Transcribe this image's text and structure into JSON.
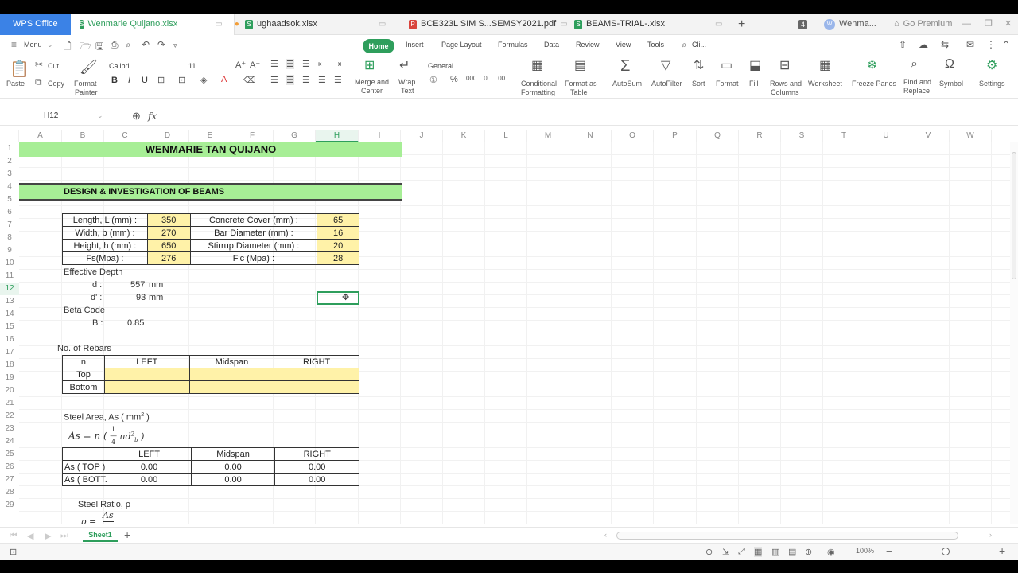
{
  "tabs": {
    "wps": "WPS Office",
    "doc1": "Wenmarie Quijano.xlsx",
    "doc2": "ughaadsok.xlsx",
    "doc3": "BCE323L SIM S...SEMSY2021.pdf",
    "doc4": "BEAMS-TRIAL-.xlsx",
    "badge": "4",
    "user": "Wenma...",
    "premium": "Go Premium"
  },
  "menu": {
    "menu": "Menu",
    "home": "Home",
    "insert": "Insert",
    "page_layout": "Page Layout",
    "formulas": "Formulas",
    "data": "Data",
    "review": "Review",
    "view": "View",
    "tools": "Tools",
    "search": "Cli..."
  },
  "ribbon": {
    "paste": "Paste",
    "cut": "Cut",
    "copy": "Copy",
    "format_painter_1": "Format",
    "format_painter_2": "Painter",
    "font": "Calibri",
    "size": "11",
    "merge_1": "Merge and",
    "merge_2": "Center",
    "wrap_1": "Wrap",
    "wrap_2": "Text",
    "number_format": "General",
    "cond_1": "Conditional",
    "cond_2": "Formatting",
    "fat_1": "Format as",
    "fat_2": "Table",
    "autosum": "AutoSum",
    "autofilter": "AutoFilter",
    "sort": "Sort",
    "format": "Format",
    "fill": "Fill",
    "rows_1": "Rows and",
    "rows_2": "Columns",
    "worksheet": "Worksheet",
    "freeze": "Freeze Panes",
    "find_1": "Find and",
    "find_2": "Replace",
    "symbol": "Symbol",
    "settings": "Settings"
  },
  "formula_bar": {
    "name_box": "H12",
    "fx": "fx"
  },
  "columns": [
    "A",
    "B",
    "C",
    "D",
    "E",
    "F",
    "G",
    "H",
    "I",
    "J",
    "K",
    "L",
    "M",
    "N",
    "O",
    "P",
    "Q",
    "R",
    "S",
    "T",
    "U",
    "V",
    "W"
  ],
  "rows": [
    "1",
    "2",
    "3",
    "4",
    "5",
    "6",
    "7",
    "8",
    "9",
    "10",
    "11",
    "12",
    "13",
    "14",
    "15",
    "16",
    "17",
    "18",
    "19",
    "20",
    "21",
    "22",
    "23",
    "24",
    "25",
    "26",
    "27",
    "28",
    "29"
  ],
  "sheet": {
    "title": "WENMARIE TAN QUIJANO",
    "section": "DESIGN & INVESTIGATION OF BEAMS",
    "params": {
      "length_label": "Length, L (mm) :",
      "length": "350",
      "cover_label": "Concrete Cover (mm) :",
      "cover": "65",
      "width_label": "Width, b (mm) :",
      "width": "270",
      "bar_label": "Bar Diameter (mm) :",
      "bar": "16",
      "height_label": "Height, h (mm) :",
      "height": "650",
      "stirrup_label": "Stirrup Diameter (mm) :",
      "stirrup": "20",
      "fs_label": "Fs(Mpa) :",
      "fs": "276",
      "fc_label": "F'c (Mpa) :",
      "fc": "28"
    },
    "eff_depth": "Effective Depth",
    "d_label": "d :",
    "d_value": "557",
    "d_unit": "mm",
    "dp_label": "d' :",
    "dp_value": "93",
    "dp_unit": "mm",
    "beta_code": "Beta Code",
    "b_label": "B :",
    "b_value": "0.85",
    "rebars_title": "No. of Rebars",
    "rebar_headers": [
      "n",
      "LEFT",
      "Midspan",
      "RIGHT"
    ],
    "rebar_top": "Top",
    "rebar_bottom": "Bottom",
    "steel_area": "Steel Area,  As ( mm",
    "steel_area_exp": "2",
    "steel_area_close": " )",
    "as_formula": "As = n (",
    "as_headers": [
      "",
      "LEFT",
      "Midspan",
      "RIGHT"
    ],
    "as_top_label": "As ( TOP )",
    "as_top": [
      "0.00",
      "0.00",
      "0.00"
    ],
    "as_bott_label": "As ( BOTT. )",
    "as_bott": [
      "0.00",
      "0.00",
      "0.00"
    ],
    "steel_ratio": "Steel Ratio, ρ",
    "rho_formula": "ρ =",
    "rho_num": "As"
  },
  "sheet_tab": "Sheet1",
  "zoom": "100%"
}
